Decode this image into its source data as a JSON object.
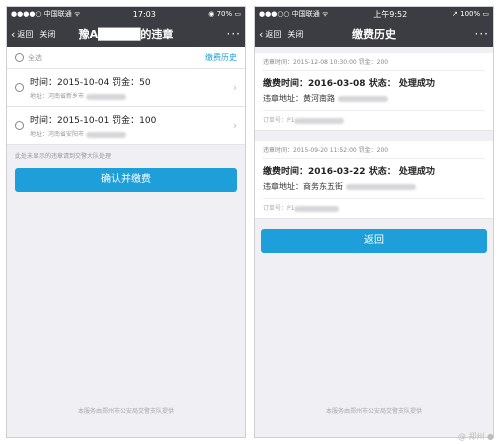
{
  "left": {
    "status": {
      "carrier": "●●●●○ 中国联通 ᯤ",
      "time": "17:03",
      "battery": "◉ 70% ▭"
    },
    "nav": {
      "back": "返回",
      "close": "关闭",
      "title": "豫A█████的违章",
      "more": "···"
    },
    "header": {
      "select_all": "全选",
      "history": "缴费历史"
    },
    "violations": [
      {
        "line1": "时间：2015-10-04 罚金：50",
        "line2": "地址：河南省新乡市"
      },
      {
        "line1": "时间：2015-10-01 罚金：100",
        "line2": "地址：河南省安阳市"
      }
    ],
    "note": "此处未显示的违章请到交警大队处理",
    "confirm_button": "确认并缴费",
    "footer": "本服务由郑州市公安局交警支队提供"
  },
  "right": {
    "status": {
      "carrier": "●●●○○ 中国联通 ᯤ",
      "time": "上午9:52",
      "battery": "↗ 100% ▭"
    },
    "nav": {
      "back": "返回",
      "close": "关闭",
      "title": "缴费历史",
      "more": "···"
    },
    "records": [
      {
        "meta": "违章时间：2015-12-08 10:30:00 罚金：200",
        "paytime": "缴费时间：2016-03-08 状态： 处理成功",
        "addr": "违章地址：黄河南路",
        "order": "订单号：P1"
      },
      {
        "meta": "违章时间：2015-09-20 11:52:00 罚金：200",
        "paytime": "缴费时间：2016-03-22 状态： 处理成功",
        "addr": "违章地址：商务东五街",
        "order": "订单号：P1"
      }
    ],
    "back_button": "返回",
    "footer": "本服务由郑州市公安局交警支队提供"
  },
  "watermark": "@ 郑州 ●"
}
